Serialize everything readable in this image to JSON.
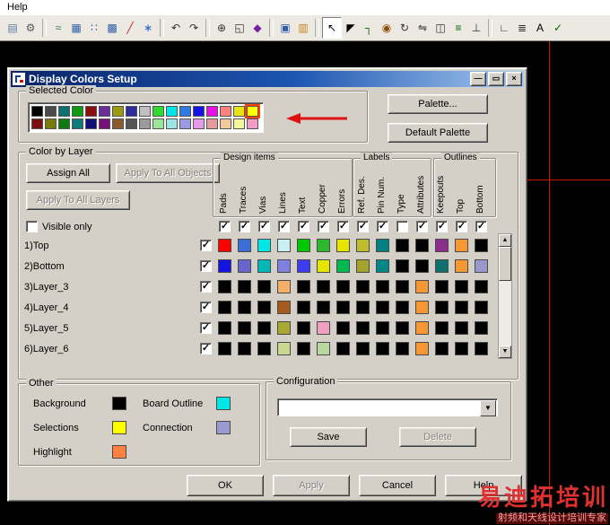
{
  "menu": {
    "help": "Help"
  },
  "glyphs": {
    "check": "✓",
    "up": "▲",
    "down": "▼",
    "dropdown": "▼",
    "minimize": "—",
    "maximize": "▭",
    "close": "×"
  },
  "toolbar": {
    "items": [
      {
        "name": "file-board-icon",
        "glyph": "▤",
        "color": "#5b7fa6"
      },
      {
        "name": "gear-icon",
        "glyph": "⚙",
        "color": "#555555"
      },
      {
        "name": "route-mode-icon",
        "glyph": "≈",
        "color": "#2e7d32",
        "sep": true
      },
      {
        "name": "grid-icon",
        "glyph": "▦",
        "color": "#2f5fa8"
      },
      {
        "name": "dots-grid-icon",
        "glyph": "∷",
        "color": "#2f5fa8"
      },
      {
        "name": "pattern-grid-icon",
        "glyph": "▩",
        "color": "#2f5fa8"
      },
      {
        "name": "draw-line-icon",
        "glyph": "╱",
        "color": "#c62828"
      },
      {
        "name": "snowflake-icon",
        "glyph": "∗",
        "color": "#1e63c8"
      },
      {
        "name": "undo-icon",
        "glyph": "↶",
        "color": "#333333",
        "sep": true
      },
      {
        "name": "redo-icon",
        "glyph": "↷",
        "color": "#333333"
      },
      {
        "name": "zoom-icon",
        "glyph": "⊕",
        "color": "#333333",
        "sep": true
      },
      {
        "name": "board-extents-icon",
        "glyph": "◱",
        "color": "#333333"
      },
      {
        "name": "color-diamond-icon",
        "glyph": "◆",
        "color": "#7b1fa2"
      },
      {
        "name": "sheet-window-icon",
        "glyph": "▣",
        "color": "#2f5fa8",
        "sep": true
      },
      {
        "name": "clipboard-icon",
        "glyph": "▥",
        "color": "#c77f16"
      },
      {
        "name": "select-arrow-icon",
        "glyph": "↖",
        "color": "#000000",
        "sep": true,
        "pressed": true
      },
      {
        "name": "select-alt-icon",
        "glyph": "◤",
        "color": "#000000"
      },
      {
        "name": "route-trace-icon",
        "glyph": "┐",
        "color": "#006600"
      },
      {
        "name": "via-icon",
        "glyph": "◉",
        "color": "#8a4b08"
      },
      {
        "name": "rotate-icon",
        "glyph": "↻",
        "color": "#333333"
      },
      {
        "name": "flip-icon",
        "glyph": "⇋",
        "color": "#333333"
      },
      {
        "name": "component-icon",
        "glyph": "◫",
        "color": "#333333"
      },
      {
        "name": "bus-icon",
        "glyph": "≡",
        "color": "#006600"
      },
      {
        "name": "pin-icon",
        "glyph": "⊥",
        "color": "#333333"
      },
      {
        "name": "corner-icon",
        "glyph": "∟",
        "color": "#333333",
        "sep": true
      },
      {
        "name": "align-icon",
        "glyph": "≣",
        "color": "#333333"
      },
      {
        "name": "text-icon",
        "glyph": "A",
        "color": "#000000"
      },
      {
        "name": "check-icon",
        "glyph": "✓",
        "color": "#006600"
      }
    ]
  },
  "workspace": {
    "crosshair_color": "#cc1500"
  },
  "watermark": {
    "line1": "易迪拓培训",
    "line2": "射频和天线设计培训专家"
  },
  "dialog": {
    "title": "Display Colors Setup",
    "selected_color": {
      "label": "Selected Color",
      "rows": [
        [
          "#000000",
          "#4b4b4b",
          "#0f7070",
          "#0f9b0f",
          "#8a0f0f",
          "#6a2e9b",
          "#9b9b0f",
          "#2e2e9b",
          "#c0c0c0",
          "#2edb2e",
          "#00e5e5",
          "#2e79e5",
          "#1414e5",
          "#e514e5",
          "#ff8080",
          "#e5e514",
          "#ffff00"
        ],
        [
          "#7a0f0f",
          "#7a7a0f",
          "#0f7a0f",
          "#0f7a7a",
          "#0f0f7a",
          "#7a0f7a",
          "#8a5a2e",
          "#555555",
          "#9b9b9b",
          "#9be59b",
          "#9be5e5",
          "#9b9be5",
          "#e59be5",
          "#e59b9b",
          "#f5c89b",
          "#f5f59b",
          "#f59bc8"
        ]
      ],
      "selected": {
        "row": 0,
        "index": 16
      }
    },
    "palette_button": "Palette...",
    "default_palette_button": "Default Palette",
    "color_by_layer": {
      "label": "Color by Layer",
      "assign_all_button": "Assign All",
      "apply_objects_button": "Apply To All Objects",
      "apply_layers_button": "Apply To All Layers",
      "visible_only_label": "Visible only",
      "visible_only_checked": false,
      "groups": [
        {
          "label": "Design items",
          "columns": [
            "Pads",
            "Traces",
            "Vias",
            "Lines",
            "Text",
            "Copper",
            "Errors"
          ]
        },
        {
          "label": "Labels",
          "columns": [
            "Ref. Des.",
            "Pin Num.",
            "Type",
            "Attributes"
          ]
        },
        {
          "label": "Outlines",
          "columns": [
            "Keepouts",
            "Top",
            "Bottom"
          ]
        }
      ],
      "header_checks": [
        true,
        true,
        true,
        true,
        true,
        true,
        true,
        true,
        true,
        false,
        true,
        true,
        true,
        true
      ],
      "layers": [
        {
          "name": "1)Top",
          "checked": true,
          "colors": [
            "#ff0000",
            "#3a6fd8",
            "#00e5e5",
            "#c8f0f0",
            "#00c800",
            "#2eb82e",
            "#e5e500",
            "#bdbd2e",
            "#008080",
            "#000000",
            "#000000",
            "#8a2e8a",
            "#f59733",
            "#000000"
          ]
        },
        {
          "name": "2)Bottom",
          "checked": true,
          "colors": [
            "#1414e0",
            "#6666cc",
            "#00b8b8",
            "#8080e0",
            "#3c3cf0",
            "#e5e500",
            "#00b850",
            "#a3a32e",
            "#008888",
            "#000000",
            "#000000",
            "#0f7070",
            "#f59733",
            "#9898cc"
          ]
        },
        {
          "name": "3)Layer_3",
          "checked": true,
          "colors": [
            "#000000",
            "#000000",
            "#000000",
            "#f5b066",
            "#000000",
            "#000000",
            "#000000",
            "#000000",
            "#000000",
            "#000000",
            "#f59733",
            "#000000",
            "#000000",
            "#000000"
          ]
        },
        {
          "name": "4)Layer_4",
          "checked": true,
          "colors": [
            "#000000",
            "#000000",
            "#000000",
            "#a85a1e",
            "#000000",
            "#000000",
            "#000000",
            "#000000",
            "#000000",
            "#000000",
            "#f59733",
            "#000000",
            "#000000",
            "#000000"
          ]
        },
        {
          "name": "5)Layer_5",
          "checked": true,
          "colors": [
            "#000000",
            "#000000",
            "#000000",
            "#a8a832",
            "#000000",
            "#f0a0c0",
            "#000000",
            "#000000",
            "#000000",
            "#000000",
            "#f59733",
            "#000000",
            "#000000",
            "#000000"
          ]
        },
        {
          "name": "6)Layer_6",
          "checked": true,
          "colors": [
            "#000000",
            "#000000",
            "#000000",
            "#c8d890",
            "#000000",
            "#b8d8a0",
            "#000000",
            "#000000",
            "#000000",
            "#000000",
            "#f59733",
            "#000000",
            "#000000",
            "#000000"
          ]
        }
      ]
    },
    "other": {
      "label": "Other",
      "items": [
        {
          "label": "Background",
          "color": "#000000"
        },
        {
          "label": "Selections",
          "color": "#ffff00"
        },
        {
          "label": "Highlight",
          "color": "#ff8040"
        },
        {
          "label": "Board Outline",
          "color": "#00e5e5"
        },
        {
          "label": "Connection",
          "color": "#9a9ad0"
        }
      ]
    },
    "configuration": {
      "label": "Configuration",
      "value": "",
      "save_button": "Save",
      "delete_button": "Delete"
    },
    "footer": {
      "ok": "OK",
      "apply": "Apply",
      "cancel": "Cancel",
      "help": "Help"
    }
  }
}
